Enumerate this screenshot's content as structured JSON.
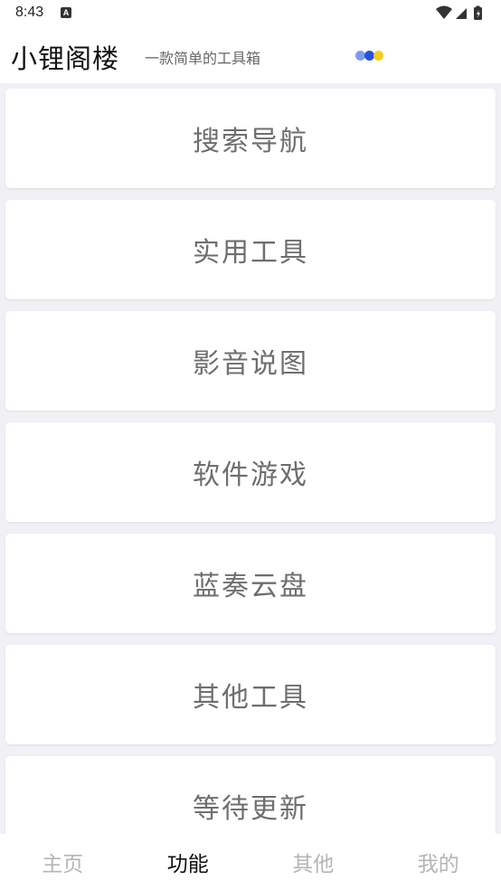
{
  "status_bar": {
    "time": "8:43",
    "notification_icon": "A"
  },
  "app_bar": {
    "title": "小锂阁楼",
    "subtitle": "一款简单的工具箱",
    "dot_colors": [
      "#7b9cf5",
      "#2a4fe0",
      "#f2cf1d"
    ]
  },
  "cards": [
    {
      "label": "搜索导航"
    },
    {
      "label": "实用工具"
    },
    {
      "label": "影音说图"
    },
    {
      "label": "软件游戏"
    },
    {
      "label": "蓝奏云盘"
    },
    {
      "label": "其他工具"
    },
    {
      "label": "等待更新"
    }
  ],
  "bottom_nav": {
    "items": [
      {
        "label": "主页",
        "active": false
      },
      {
        "label": "功能",
        "active": true
      },
      {
        "label": "其他",
        "active": false
      },
      {
        "label": "我的",
        "active": false
      }
    ]
  },
  "colors": {
    "background": "#f0f0f5",
    "card": "#ffffff",
    "card_text": "#6e6e6e",
    "nav_active": "#111111",
    "nav_inactive": "#b5b5b5"
  }
}
